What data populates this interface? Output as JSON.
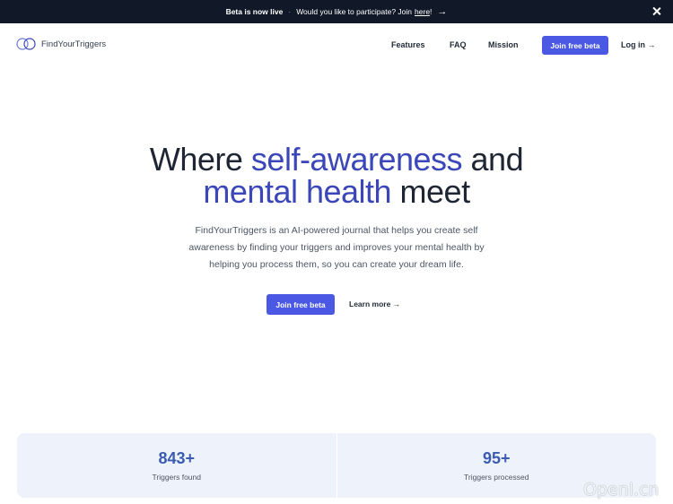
{
  "banner": {
    "title": "Beta is now live",
    "separator": "·",
    "question": "Would you like to participate? Join",
    "link": "here",
    "suffix": "!",
    "arrow": "→",
    "close_icon": "close-icon"
  },
  "nav": {
    "brand": "FindYourTriggers",
    "logo_icon": "two-circles-logo",
    "links": [
      "Features",
      "FAQ",
      "Mission"
    ],
    "join_button": "Join free beta",
    "login": "Log in →"
  },
  "hero": {
    "title_part1": "Where ",
    "title_accent1": "self-awareness",
    "title_part2": " and",
    "title_accent2": "mental health",
    "title_part3": " meet",
    "description": "FindYourTriggers is an AI-powered journal that helps you create self awareness by finding your triggers and improves your mental health by helping you process them, so you can create your dream life.",
    "cta_button": "Join free beta",
    "learn_more": "Learn more →"
  },
  "stats": [
    {
      "value": "843+",
      "label": "Triggers found"
    },
    {
      "value": "95+",
      "label": "Triggers processed"
    }
  ],
  "watermark": "Openl.cn",
  "colors": {
    "accent": "#4a58e4",
    "accent_text": "#3b47b8",
    "banner_bg": "#111827",
    "stat_bg": "#eef3fb"
  }
}
